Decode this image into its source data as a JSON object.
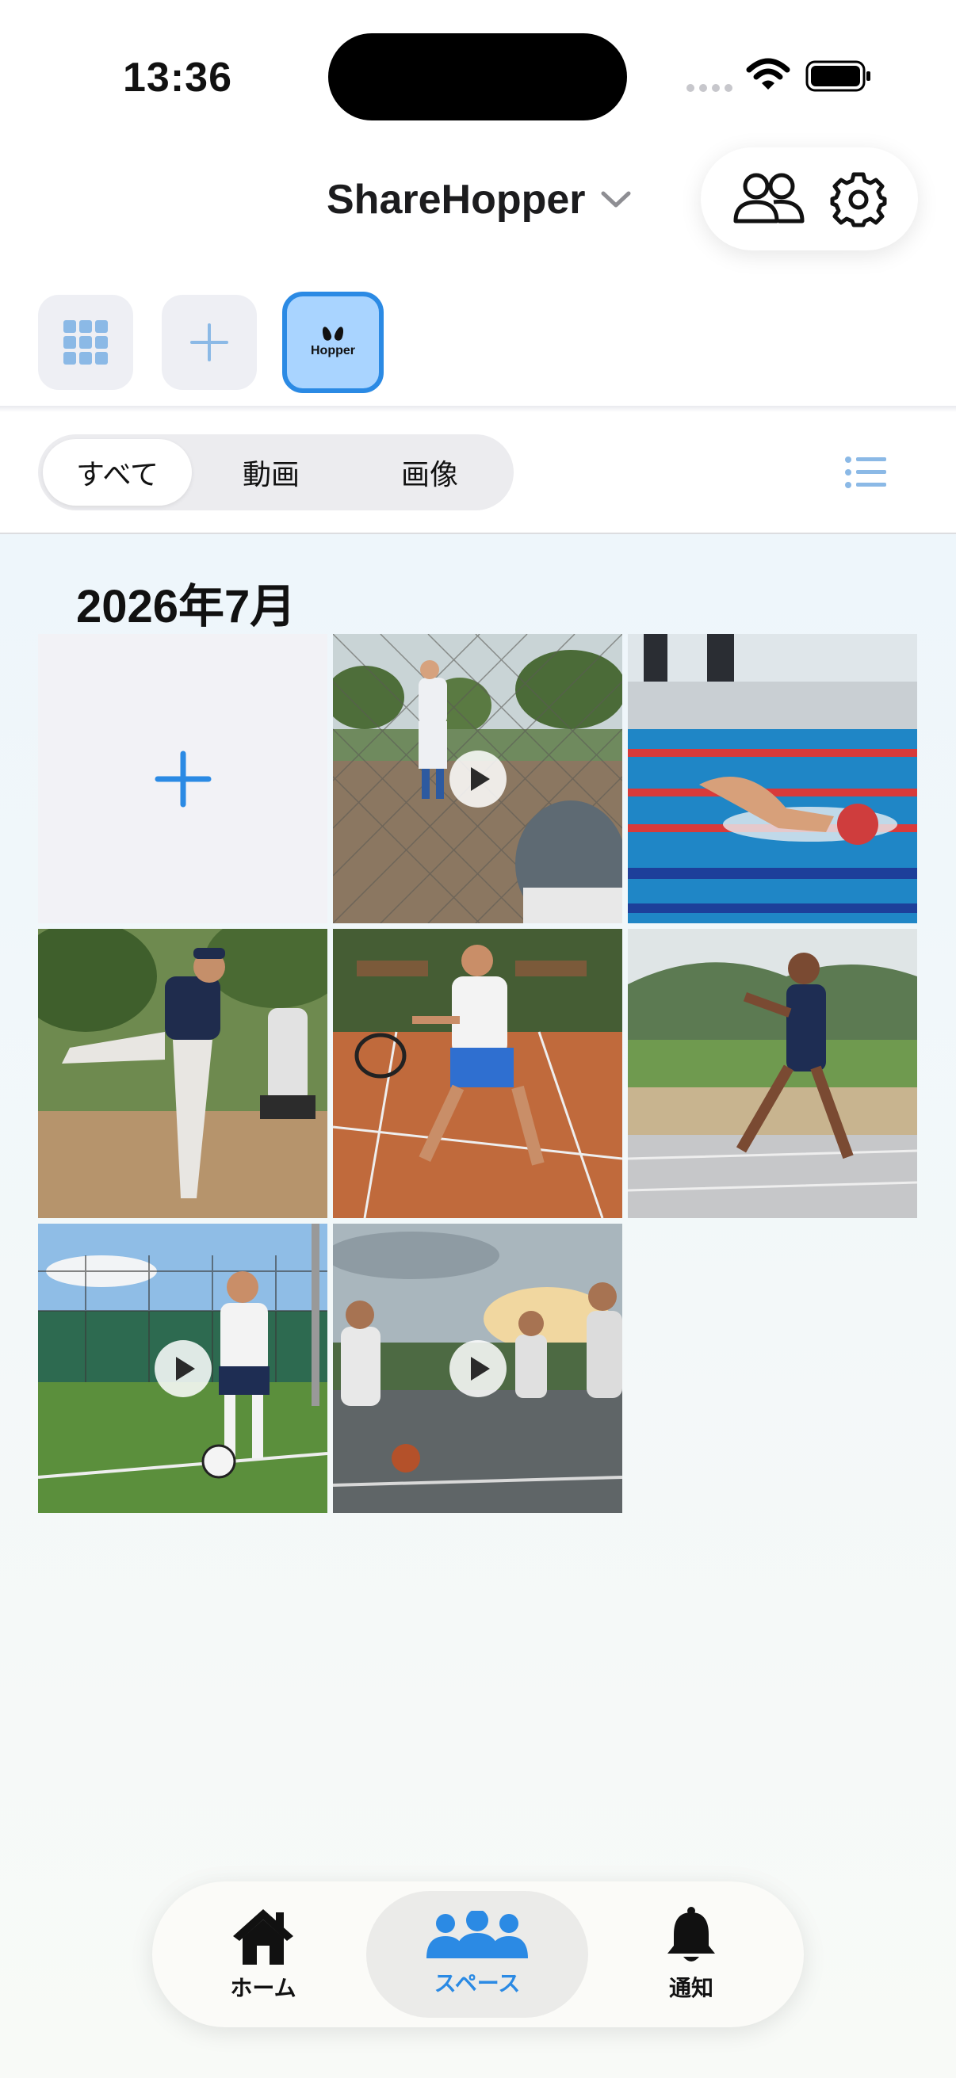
{
  "status_bar": {
    "time": "13:36"
  },
  "header": {
    "app_title": "ShareHopper"
  },
  "spaces": {
    "hopper_label": "Hopper"
  },
  "filter": {
    "tabs": [
      "すべて",
      "動画",
      "画像"
    ],
    "active": "すべて"
  },
  "gallery": {
    "month_heading": "2026年7月",
    "items": [
      {
        "kind": "add"
      },
      {
        "kind": "video",
        "scene": "baseball-pitcher-through-fence"
      },
      {
        "kind": "image",
        "scene": "swimmer-pool"
      },
      {
        "kind": "image",
        "scene": "baseball-pitcher-tokyo-21"
      },
      {
        "kind": "image",
        "scene": "tennis-clay-court"
      },
      {
        "kind": "image",
        "scene": "track-runner"
      },
      {
        "kind": "video",
        "scene": "soccer-player"
      },
      {
        "kind": "video",
        "scene": "basketball-outdoor"
      }
    ]
  },
  "tabbar": {
    "home_label": "ホーム",
    "space_label": "スペース",
    "notifications_label": "通知",
    "active": "スペース"
  },
  "colors": {
    "accent": "#2b8ae4",
    "chip_active_bg": "#a9d4ff",
    "chip_bg": "#eeeff4"
  }
}
